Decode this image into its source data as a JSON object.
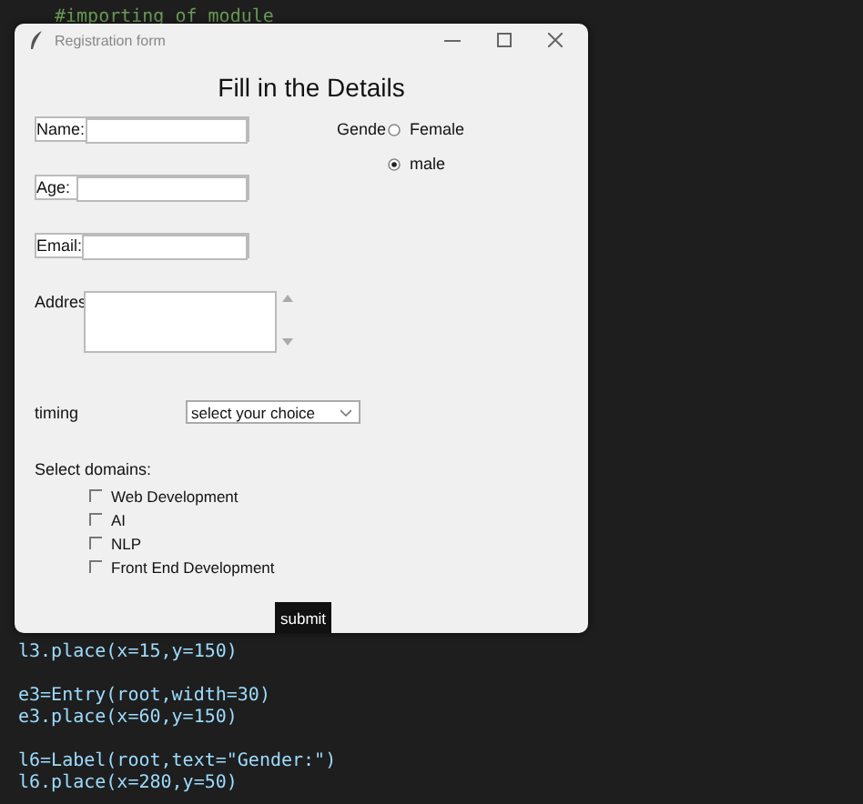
{
  "editor": {
    "top_lines": [
      {
        "text": "#importing of module",
        "kind": "comment"
      }
    ],
    "bottom_lines": [
      {
        "text": "l3.place(x=15,y=150)",
        "kind": "code"
      },
      {
        "kind": "blank"
      },
      {
        "text": "e3=Entry(root,width=30)",
        "kind": "code"
      },
      {
        "text": "e3.place(x=60,y=150)",
        "kind": "code"
      },
      {
        "kind": "blank"
      },
      {
        "text": "l6=Label(root,text=\"Gender:\")",
        "kind": "code"
      },
      {
        "text": "l6.place(x=280,y=50)",
        "kind": "code"
      }
    ]
  },
  "window": {
    "title": "Registration form",
    "heading": "Fill in the Details",
    "fields": [
      {
        "label": "Name:",
        "kind": "entry"
      },
      {
        "label": "Age:",
        "kind": "entry"
      },
      {
        "label": "Email:",
        "kind": "entry"
      },
      {
        "label": "Addres",
        "kind": "text"
      }
    ],
    "gender": {
      "label": "Gende",
      "options": [
        {
          "label": "Female",
          "selected": false
        },
        {
          "label": "male",
          "selected": true
        }
      ]
    },
    "timing": {
      "label": "timing",
      "value": "select your choice"
    },
    "domains": {
      "label": "Select domains:",
      "options": [
        {
          "label": "Web Development",
          "checked": false
        },
        {
          "label": "AI",
          "checked": false
        },
        {
          "label": "NLP",
          "checked": false
        },
        {
          "label": "Front End Development",
          "checked": false
        }
      ]
    },
    "submit": "submit"
  }
}
